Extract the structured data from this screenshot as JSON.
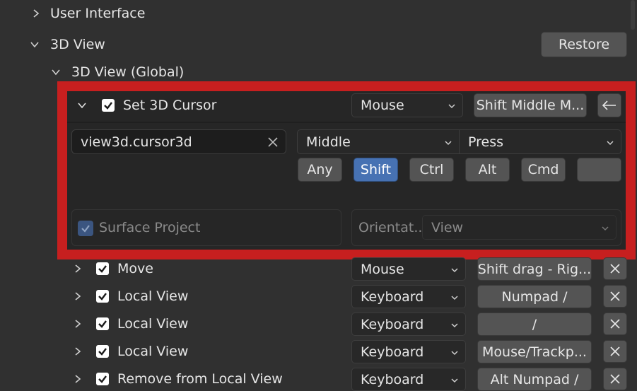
{
  "tree": {
    "user_interface": {
      "label": "User Interface",
      "expanded": false
    },
    "view3d": {
      "label": "3D View",
      "expanded": true,
      "restore_label": "Restore"
    },
    "view3d_global": {
      "label": "3D View (Global)",
      "expanded": true
    }
  },
  "expanded_item": {
    "name": "Set 3D Cursor",
    "enabled": true,
    "input_type": "Mouse",
    "shortcut_label": "Shift Middle M...",
    "back_icon": "left-arrow-icon",
    "operator_id": "view3d.cursor3d",
    "button": "Middle",
    "event": "Press",
    "modifiers": [
      {
        "label": "Any",
        "active": false
      },
      {
        "label": "Shift",
        "active": true
      },
      {
        "label": "Ctrl",
        "active": false
      },
      {
        "label": "Alt",
        "active": false
      },
      {
        "label": "Cmd",
        "active": false
      },
      {
        "label": "",
        "active": false
      }
    ],
    "surface_project": {
      "label": "Surface Project",
      "checked": true,
      "disabled": true
    },
    "orientation": {
      "label": "Orientat...",
      "value": "View",
      "disabled": true
    }
  },
  "keymap_rows": [
    {
      "name": "Move",
      "enabled": true,
      "input_type": "Mouse",
      "shortcut": "Shift drag - Rig..."
    },
    {
      "name": "Local View",
      "enabled": true,
      "input_type": "Keyboard",
      "shortcut": "Numpad /"
    },
    {
      "name": "Local View",
      "enabled": true,
      "input_type": "Keyboard",
      "shortcut": "/"
    },
    {
      "name": "Local View",
      "enabled": true,
      "input_type": "Keyboard",
      "shortcut": "Mouse/Trackp..."
    },
    {
      "name": "Remove from Local View",
      "enabled": true,
      "input_type": "Keyboard",
      "shortcut": "Alt Numpad /"
    }
  ],
  "colors": {
    "background": "#303030",
    "highlight_frame": "#c71f1f",
    "active_modifier": "#4772b3",
    "button": "#545454",
    "field": "#282828"
  }
}
